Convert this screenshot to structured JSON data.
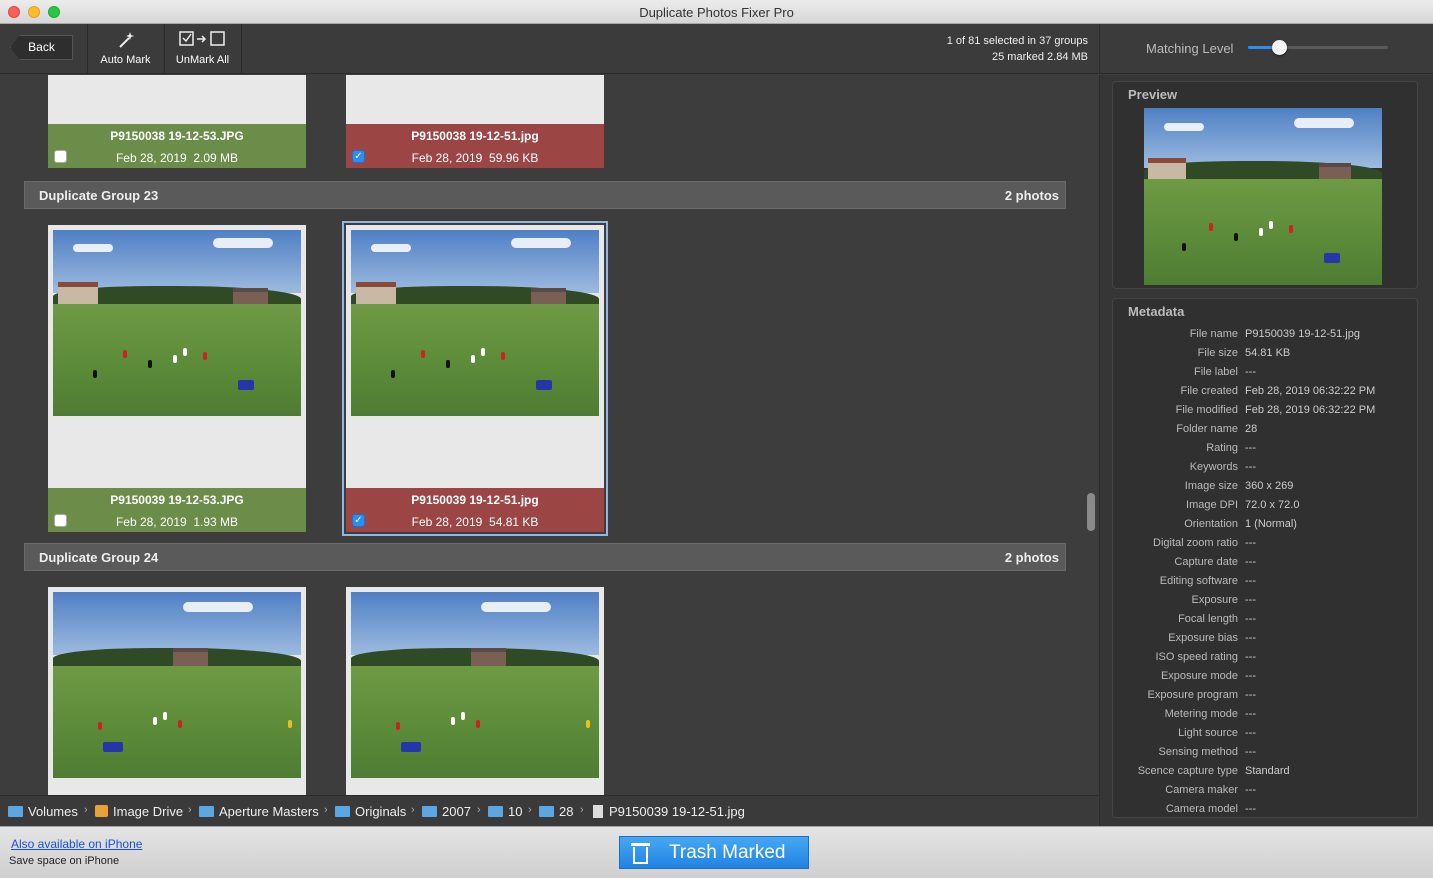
{
  "window": {
    "title": "Duplicate Photos Fixer Pro"
  },
  "toolbar": {
    "back_label": "Back",
    "auto_mark_label": "Auto Mark",
    "unmark_all_label": "UnMark All",
    "status_line1": "1 of 81 selected in 37 groups",
    "status_line2": "25 marked 2.84 MB"
  },
  "matching": {
    "label": "Matching Level",
    "level": 0.22
  },
  "groups": [
    {
      "name": "",
      "count": "",
      "cards": [
        {
          "file": "P9150038 19-12-53.JPG",
          "date": "Feb 28, 2019",
          "size": "2.09 MB",
          "marked": false
        },
        {
          "file": "P9150038 19-12-51.jpg",
          "date": "Feb 28, 2019",
          "size": "59.96 KB",
          "marked": true
        }
      ]
    },
    {
      "name": "Duplicate Group 23",
      "count": "2 photos",
      "cards": [
        {
          "file": "P9150039 19-12-53.JPG",
          "date": "Feb 28, 2019",
          "size": "1.93 MB",
          "marked": false
        },
        {
          "file": "P9150039 19-12-51.jpg",
          "date": "Feb 28, 2019",
          "size": "54.81 KB",
          "marked": true
        }
      ]
    },
    {
      "name": "Duplicate Group 24",
      "count": "2 photos",
      "cards": []
    }
  ],
  "breadcrumb": {
    "items": [
      "Volumes",
      "Image Drive",
      "Aperture Masters",
      "Originals",
      "2007",
      "10",
      "28",
      "P9150039 19-12-51.jpg"
    ]
  },
  "bottom": {
    "iphone_link": "Also available on iPhone",
    "iphone_sub": "Save space on iPhone",
    "trash_label": "Trash Marked"
  },
  "preview": {
    "title": "Preview"
  },
  "metadata": {
    "title": "Metadata",
    "rows": [
      {
        "key": "File name",
        "value": "P9150039 19-12-51.jpg"
      },
      {
        "key": "File size",
        "value": "54.81 KB"
      },
      {
        "key": "File label",
        "value": "---"
      },
      {
        "key": "File created",
        "value": "Feb 28, 2019 06:32:22 PM"
      },
      {
        "key": "File modified",
        "value": "Feb 28, 2019 06:32:22 PM"
      },
      {
        "key": "Folder name",
        "value": "28"
      },
      {
        "key": "Rating",
        "value": "---"
      },
      {
        "key": "Keywords",
        "value": "---"
      },
      {
        "key": "Image size",
        "value": "360 x 269"
      },
      {
        "key": "Image DPI",
        "value": "72.0 x 72.0"
      },
      {
        "key": "Orientation",
        "value": "1 (Normal)"
      },
      {
        "key": "Digital zoom ratio",
        "value": "---"
      },
      {
        "key": "Capture date",
        "value": "---"
      },
      {
        "key": "Editing software",
        "value": "---"
      },
      {
        "key": "Exposure",
        "value": "---"
      },
      {
        "key": "Focal length",
        "value": "---"
      },
      {
        "key": "Exposure bias",
        "value": "---"
      },
      {
        "key": "ISO speed rating",
        "value": "---"
      },
      {
        "key": "Exposure mode",
        "value": "---"
      },
      {
        "key": "Exposure program",
        "value": "---"
      },
      {
        "key": "Metering mode",
        "value": "---"
      },
      {
        "key": "Light source",
        "value": "---"
      },
      {
        "key": "Sensing method",
        "value": "---"
      },
      {
        "key": "Scence capture type",
        "value": "Standard"
      },
      {
        "key": "Camera maker",
        "value": "---"
      },
      {
        "key": "Camera model",
        "value": "---"
      }
    ]
  },
  "colors": {
    "accent": "#2b8ef3",
    "keep": "#6c8c4a",
    "marked": "#9b4545"
  }
}
